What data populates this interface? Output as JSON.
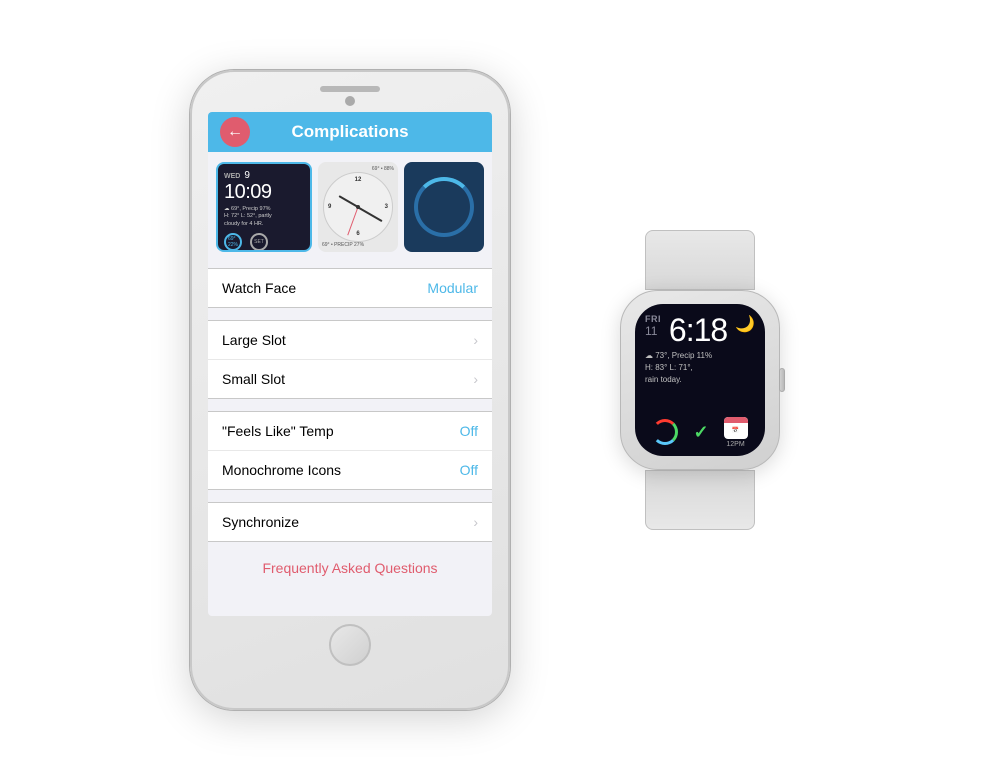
{
  "iphone": {
    "header": {
      "title": "Complications",
      "back_arrow": "←"
    },
    "watch_previews": [
      {
        "type": "digital",
        "selected": true,
        "day": "WED",
        "date": "9",
        "time": "10:09",
        "weather": "69°, Precip 97%\nH: 72° L: 52°, partly\ncloudy for 4 HR.",
        "bottom_left": "69°\n22%",
        "bottom_right": "SET"
      },
      {
        "type": "analog",
        "temp_top": "69° • 88%",
        "weather_bottom": "69° • PRECIP 27%"
      },
      {
        "type": "blue"
      }
    ],
    "settings": [
      {
        "section": 1,
        "rows": [
          {
            "label": "Watch Face",
            "value": "Modular",
            "chevron": false
          }
        ]
      },
      {
        "section": 2,
        "rows": [
          {
            "label": "Large Slot",
            "value": "",
            "chevron": true
          },
          {
            "label": "Small Slot",
            "value": "",
            "chevron": true
          }
        ]
      },
      {
        "section": 3,
        "rows": [
          {
            "label": "\"Feels Like\" Temp",
            "value": "Off",
            "chevron": false
          },
          {
            "label": "Monochrome Icons",
            "value": "Off",
            "chevron": false
          }
        ]
      },
      {
        "section": 4,
        "rows": [
          {
            "label": "Synchronize",
            "value": "",
            "chevron": true
          }
        ]
      }
    ],
    "faq_label": "Frequently Asked Questions"
  },
  "apple_watch": {
    "screen": {
      "day_label": "FRI",
      "day_num": "11",
      "time": "6:18",
      "moon_icon": "🌙",
      "weather_line1": "73°, Precip 11%",
      "weather_line2": "H: 83° L: 71°,",
      "weather_line3": "rain today.",
      "bottom_label": "12PM"
    }
  },
  "colors": {
    "accent_blue": "#4db8e8",
    "accent_red": "#e05c6e",
    "watch_bg": "#0a0a1a"
  }
}
